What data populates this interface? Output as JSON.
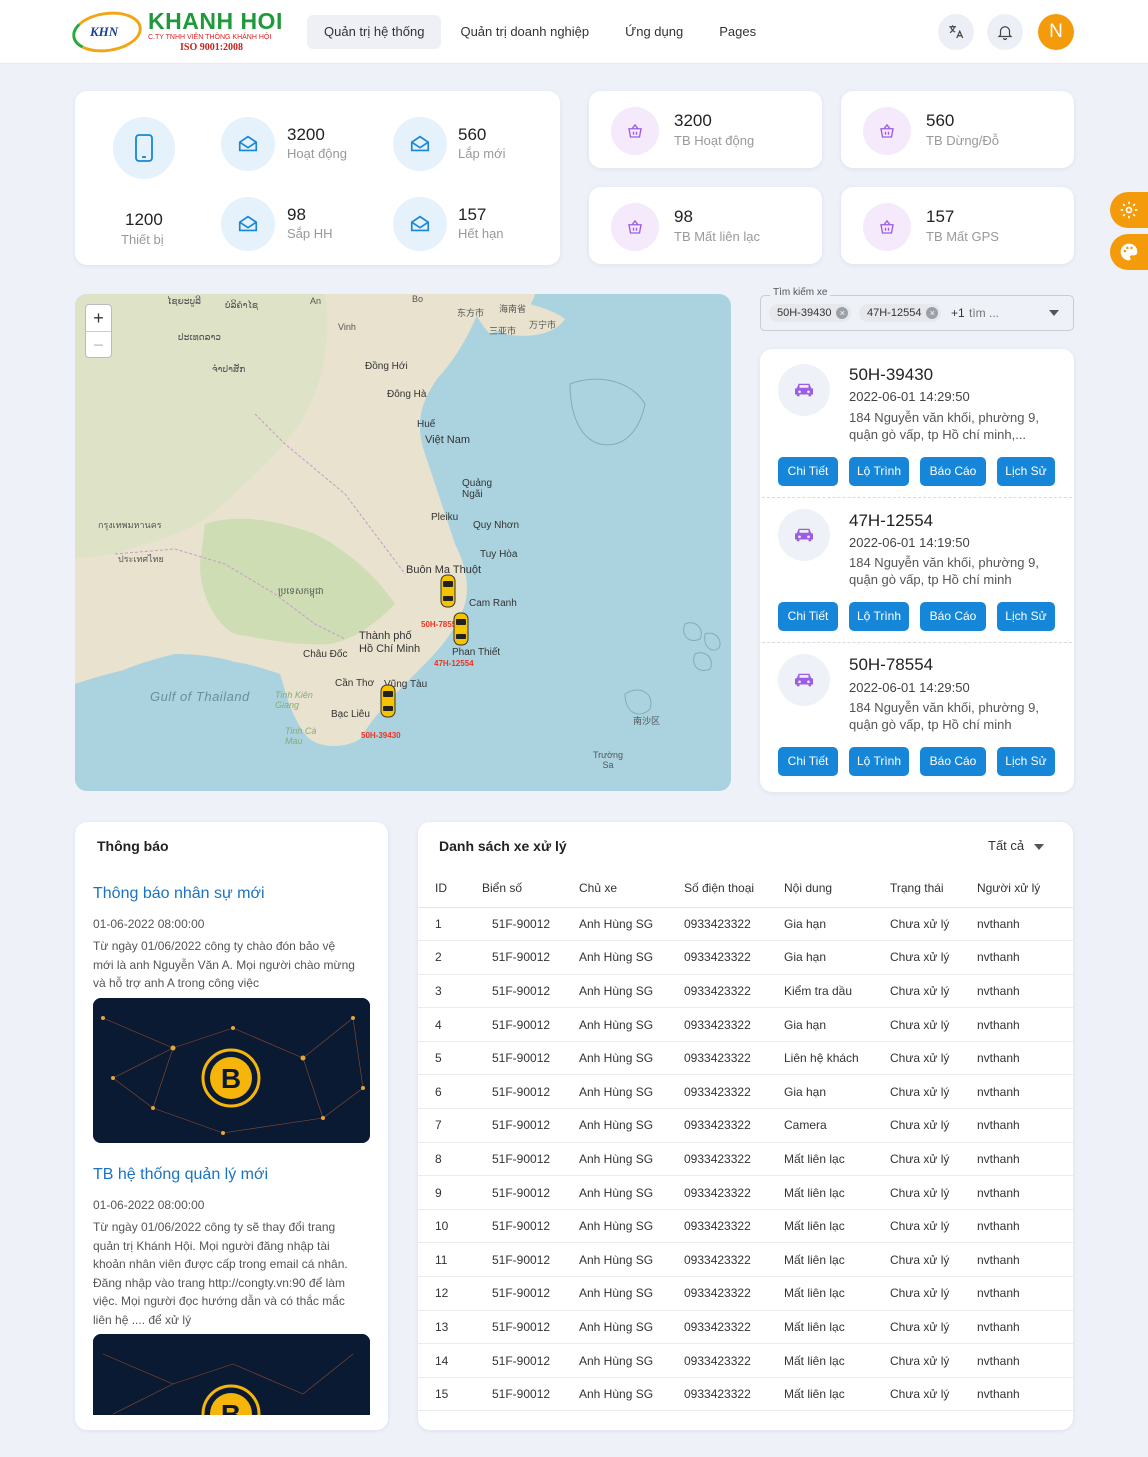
{
  "header": {
    "logo": {
      "mark": "KHN",
      "name": "KHANH HOI",
      "subtitle": "C.TY TNHH VIÊN THÔNG KHÁNH HỘI",
      "iso": "ISO 9001:2008"
    },
    "nav": [
      "Quản trị hệ thống",
      "Quản trị doanh nghiệp",
      "Ứng dụng",
      "Pages"
    ],
    "avatar_letter": "N"
  },
  "device_stats": {
    "total": {
      "value": "1200",
      "label": "Thiết bị"
    },
    "items": [
      {
        "value": "3200",
        "label": "Hoạt động"
      },
      {
        "value": "560",
        "label": "Lắp mới"
      },
      {
        "value": "98",
        "label": "Sắp HH"
      },
      {
        "value": "157",
        "label": "Hết hạn"
      }
    ]
  },
  "vehicle_stats": [
    {
      "value": "3200",
      "label": "TB Hoạt động"
    },
    {
      "value": "560",
      "label": "TB Dừng/Đỗ"
    },
    {
      "value": "98",
      "label": "TB Mất liên lạc"
    },
    {
      "value": "157",
      "label": "TB Mất GPS"
    }
  ],
  "map": {
    "labels": {
      "l1": "ໄຊຍະບູລີ",
      "l2": "ບໍລິຄໍາໄຊ",
      "l3": "An",
      "l4": "Vinh",
      "l5": "Bo",
      "l6": "东方市",
      "l7": "海南省",
      "l8": "万宁市",
      "l9": "三亚市",
      "l10": "ປະເທດລາວ",
      "l11": "ຈຳປາສັກ",
      "l12": "Đồng Hới",
      "l13": "Đông Hà",
      "l14": "Huế",
      "l15": "Việt Nam",
      "l16": "Quảng Ngãi",
      "l17": "Pleiku",
      "l18": "Quy Nhơn",
      "l19": "Tuy Hòa",
      "l20": "Buôn Ma Thuột",
      "l21": "Cam Ranh",
      "l22": "ប្រទេសកម្ពុជា",
      "l23": "Thành phố Hồ Chí Minh",
      "l24": "Châu Đốc",
      "l25": "Cần Thơ",
      "l26": "Vũng Tàu",
      "l27": "Bạc Liêu",
      "l28": "Phan Thiết",
      "l29": "Gulf of Thailand",
      "l30": "Tinh Kiên Giang",
      "l31": "Tinh Cà Mau",
      "l32": "Trường Sa",
      "l33": "南沙区",
      "l34": "ประเทศไทย",
      "l35": "กรุงเทพมหานคร"
    },
    "markers": [
      "50H-78554",
      "47H-12554",
      "50H-39430"
    ],
    "zoom_in": "+",
    "zoom_out": "−"
  },
  "search": {
    "legend": "Tìm kiếm xe",
    "chips": [
      "50H-39430",
      "47H-12554"
    ],
    "more": "+1",
    "placeholder": "tìm ..."
  },
  "vehicles": [
    {
      "plate": "50H-39430",
      "time": "2022-06-01 14:29:50",
      "address": "184 Nguyễn văn khối, phường 9, quận gò vấp, tp Hồ chí minh,..."
    },
    {
      "plate": "47H-12554",
      "time": "2022-06-01 14:19:50",
      "address": "184 Nguyễn văn khối, phường 9, quận gò vấp, tp Hồ chí minh"
    },
    {
      "plate": "50H-78554",
      "time": "2022-06-01 14:29:50",
      "address": "184 Nguyễn văn khối, phường 9, quận gò vấp, tp Hồ chí minh"
    }
  ],
  "vehicle_actions": [
    "Chi Tiết",
    "Lộ Trình",
    "Báo Cáo",
    "Lịch Sử"
  ],
  "notifications": {
    "title": "Thông báo",
    "items": [
      {
        "title": "Thông báo nhân sự mới",
        "date": "01-06-2022 08:00:00",
        "body": "Từ ngày 01/06/2022 công ty chào đón bảo vệ mới là anh Nguyễn Văn A. Mọi người chào mừng và hỗ trợ anh A trong công việc"
      },
      {
        "title": "TB hệ thống quản lý mới",
        "date": "01-06-2022 08:00:00",
        "body": "Từ ngày 01/06/2022 công ty sẽ thay đổi trang quản trị Khánh Hội. Mọi người đăng nhập tài khoản nhân viên được cấp trong email cá nhân. Đăng nhập vào trang http://congty.vn:90 để làm việc. Mọi người đọc hướng dẫn và có thắc mắc liên hệ .... để xử lý"
      }
    ]
  },
  "processing": {
    "title": "Danh sách xe xử lý",
    "filter": "Tất cả",
    "columns": [
      "ID",
      "Biển số",
      "Chủ xe",
      "Số điện thoại",
      "Nội dung",
      "Trạng thái",
      "Người xử lý"
    ],
    "rows": [
      [
        "1",
        "51F-90012",
        "Anh Hùng SG",
        "0933423322",
        "Gia hạn",
        "Chưa xử lý",
        "nvthanh"
      ],
      [
        "2",
        "51F-90012",
        "Anh Hùng SG",
        "0933423322",
        "Gia hạn",
        "Chưa xử lý",
        "nvthanh"
      ],
      [
        "3",
        "51F-90012",
        "Anh Hùng SG",
        "0933423322",
        "Kiểm tra dầu",
        "Chưa xử lý",
        "nvthanh"
      ],
      [
        "4",
        "51F-90012",
        "Anh Hùng SG",
        "0933423322",
        "Gia hạn",
        "Chưa xử lý",
        "nvthanh"
      ],
      [
        "5",
        "51F-90012",
        "Anh Hùng SG",
        "0933423322",
        "Liên hệ khách",
        "Chưa xử lý",
        "nvthanh"
      ],
      [
        "6",
        "51F-90012",
        "Anh Hùng SG",
        "0933423322",
        "Gia hạn",
        "Chưa xử lý",
        "nvthanh"
      ],
      [
        "7",
        "51F-90012",
        "Anh Hùng SG",
        "0933423322",
        "Camera",
        "Chưa xử lý",
        "nvthanh"
      ],
      [
        "8",
        "51F-90012",
        "Anh Hùng SG",
        "0933423322",
        "Mất liên lạc",
        "Chưa xử lý",
        "nvthanh"
      ],
      [
        "9",
        "51F-90012",
        "Anh Hùng SG",
        "0933423322",
        "Mất liên lạc",
        "Chưa xử lý",
        "nvthanh"
      ],
      [
        "10",
        "51F-90012",
        "Anh Hùng SG",
        "0933423322",
        "Mất liên lạc",
        "Chưa xử lý",
        "nvthanh"
      ],
      [
        "11",
        "51F-90012",
        "Anh Hùng SG",
        "0933423322",
        "Mất liên lạc",
        "Chưa xử lý",
        "nvthanh"
      ],
      [
        "12",
        "51F-90012",
        "Anh Hùng SG",
        "0933423322",
        "Mất liên lạc",
        "Chưa xử lý",
        "nvthanh"
      ],
      [
        "13",
        "51F-90012",
        "Anh Hùng SG",
        "0933423322",
        "Mất liên lạc",
        "Chưa xử lý",
        "nvthanh"
      ],
      [
        "14",
        "51F-90012",
        "Anh Hùng SG",
        "0933423322",
        "Mất liên lạc",
        "Chưa xử lý",
        "nvthanh"
      ],
      [
        "15",
        "51F-90012",
        "Anh Hùng SG",
        "0933423322",
        "Mất liên lạc",
        "Chưa xử lý",
        "nvthanh"
      ]
    ]
  },
  "colors": {
    "accent": "#1686d8",
    "orange": "#f39b0a",
    "logo_green": "#1e9a3a",
    "link_blue": "#1a73c2",
    "purple_icon": "#9b5de5",
    "blue_icon": "#1686d8"
  },
  "icons": {
    "translate": "translate-icon",
    "bell": "bell-icon",
    "settings": "gear-icon",
    "palette": "palette-icon",
    "phone": "phone-icon",
    "mail": "mail-open-icon",
    "basket": "basket-icon",
    "car": "car-icon",
    "bitcoin": "bitcoin-icon"
  }
}
